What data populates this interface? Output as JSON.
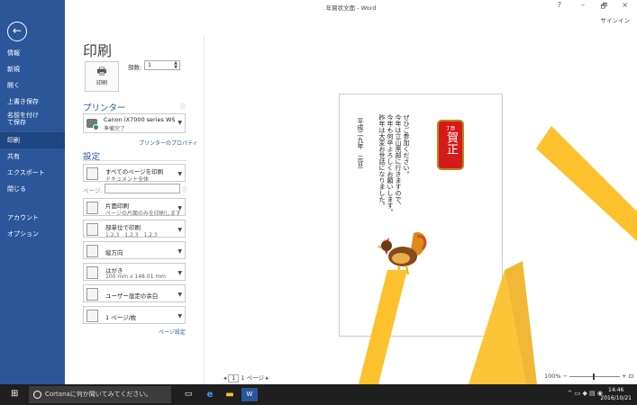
{
  "window": {
    "title": "年賀状文面 - Word",
    "help_glyph": "?",
    "minimize_glyph": "–",
    "maximize_glyph": "🗗",
    "close_glyph": "×",
    "signin": "サインイン"
  },
  "nav": {
    "back_glyph": "←",
    "items": [
      "情報",
      "新規",
      "開く",
      "上書き保存",
      "名前を付けて保存",
      "印刷",
      "共有",
      "エクスポート",
      "閉じる",
      "アカウント",
      "オプション"
    ],
    "selected": "印刷"
  },
  "print_panel": {
    "title": "印刷",
    "print_button_label": "印刷",
    "copies_label": "部数:",
    "copies_value": "1",
    "printer_section": "プリンター",
    "printer_name": "Canon iX7000 series WS",
    "printer_status": "準備完了",
    "printer_properties_link": "プリンターのプロパティ",
    "settings_section": "設定",
    "options": [
      {
        "title": "すべてのページを印刷",
        "sub": "ドキュメント全体"
      },
      {
        "title": "片面印刷",
        "sub": "ページの片面のみを印刷します"
      },
      {
        "title": "部単位で印刷",
        "sub": "1,2,3　1,2,3　1,2,3"
      },
      {
        "title": "縦方向",
        "sub": ""
      },
      {
        "title": "はがき",
        "sub": "100 mm x 148.01 mm"
      },
      {
        "title": "ユーザー設定の余白",
        "sub": ""
      },
      {
        "title": "1 ページ/枚",
        "sub": ""
      }
    ],
    "pages_label": "ページ:",
    "page_setup_link": "ページ設定",
    "info_glyph": "ⓘ"
  },
  "preview": {
    "greeting_lines": [
      "昨年は大変お世話になりました。",
      "今年も何卒よろしくお願いします。",
      "今年は立山黒部に行きますので、",
      "ぜひご参加ください。"
    ],
    "date_line": "平成二九年　元旦",
    "stamp_text": "賀正",
    "stamp_small": "丁酉",
    "page_current": "1",
    "page_total": "1 ページ",
    "zoom": "100%"
  },
  "taskbar": {
    "cortana_placeholder": "Cortanaに何か聞いてみてください。",
    "time": "14:46",
    "date": "2016/10/21"
  },
  "colors": {
    "accent": "#2b579a",
    "stamp_red": "#d41a1a",
    "highlight_yellow": "#fcc12c",
    "taskbar": "#1f1f1f"
  }
}
